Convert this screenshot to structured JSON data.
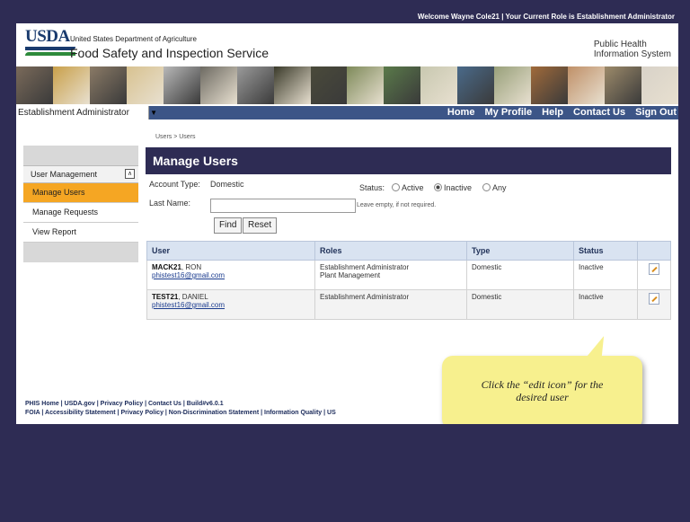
{
  "topbar": {
    "text": "Welcome Wayne Cole21  |  Your Current Role is Establishment Administrator"
  },
  "header": {
    "logo": "USDA",
    "department": "United States Department of Agriculture",
    "agency": "Food Safety and Inspection Service",
    "system_line1": "Public Health",
    "system_line2": "Information System"
  },
  "banner_colors": [
    "#7a6a5a",
    "#c9a04a",
    "#8a7a66",
    "#d8c290",
    "#b8b8b8",
    "#6d6a62",
    "#9a9a9a",
    "#3a3a2a",
    "#4a4a3a",
    "#7e8a5a",
    "#5a7a4a",
    "#c8c8b0",
    "#4a6a8a",
    "#98a07a",
    "#a06a3a",
    "#c09068",
    "#9c8a6a",
    "#d8d2c8"
  ],
  "nav": {
    "role": "Establishment Administrator",
    "links": [
      "Home",
      "My Profile",
      "Help",
      "Contact Us",
      "Sign Out"
    ]
  },
  "breadcrumb": "Users > Users",
  "sidebar": {
    "header": "User Management",
    "toggle": "∧",
    "items": [
      "Manage Users",
      "Manage Requests",
      "View Report"
    ]
  },
  "page": {
    "title": "Manage Users",
    "account_type_label": "Account Type:",
    "account_type_value": "Domestic",
    "status_label": "Status:",
    "status_options": [
      "Active",
      "Inactive",
      "Any"
    ],
    "selected_status": "Inactive",
    "last_name_label": "Last Name:",
    "last_name_value": "",
    "last_name_hint": "Leave empty, if not required.",
    "find_label": "Find",
    "reset_label": "Reset"
  },
  "table": {
    "headers": [
      "User",
      "Roles",
      "Type",
      "Status",
      ""
    ],
    "rows": [
      {
        "username": "MACK21",
        "name": ", RON",
        "email": "phistest16@gmail.com",
        "roles": [
          "Establishment Administrator",
          "Plant Management"
        ],
        "type": "Domestic",
        "status": "Inactive"
      },
      {
        "username": "TEST21",
        "name": ", DANIEL",
        "email": "phistest16@gmail.com",
        "roles": [
          "Establishment Administrator"
        ],
        "type": "Domestic",
        "status": "Inactive"
      }
    ]
  },
  "footer": {
    "line1": "PHIS Home | USDA.gov | Privacy Policy | Contact Us | Build#v6.0.1",
    "line2": "FOIA | Accessibility Statement | Privacy Policy | Non-Discrimination Statement | Information Quality | US"
  },
  "callout": {
    "line1": "Click the “edit icon” for the",
    "line2": "desired user"
  }
}
